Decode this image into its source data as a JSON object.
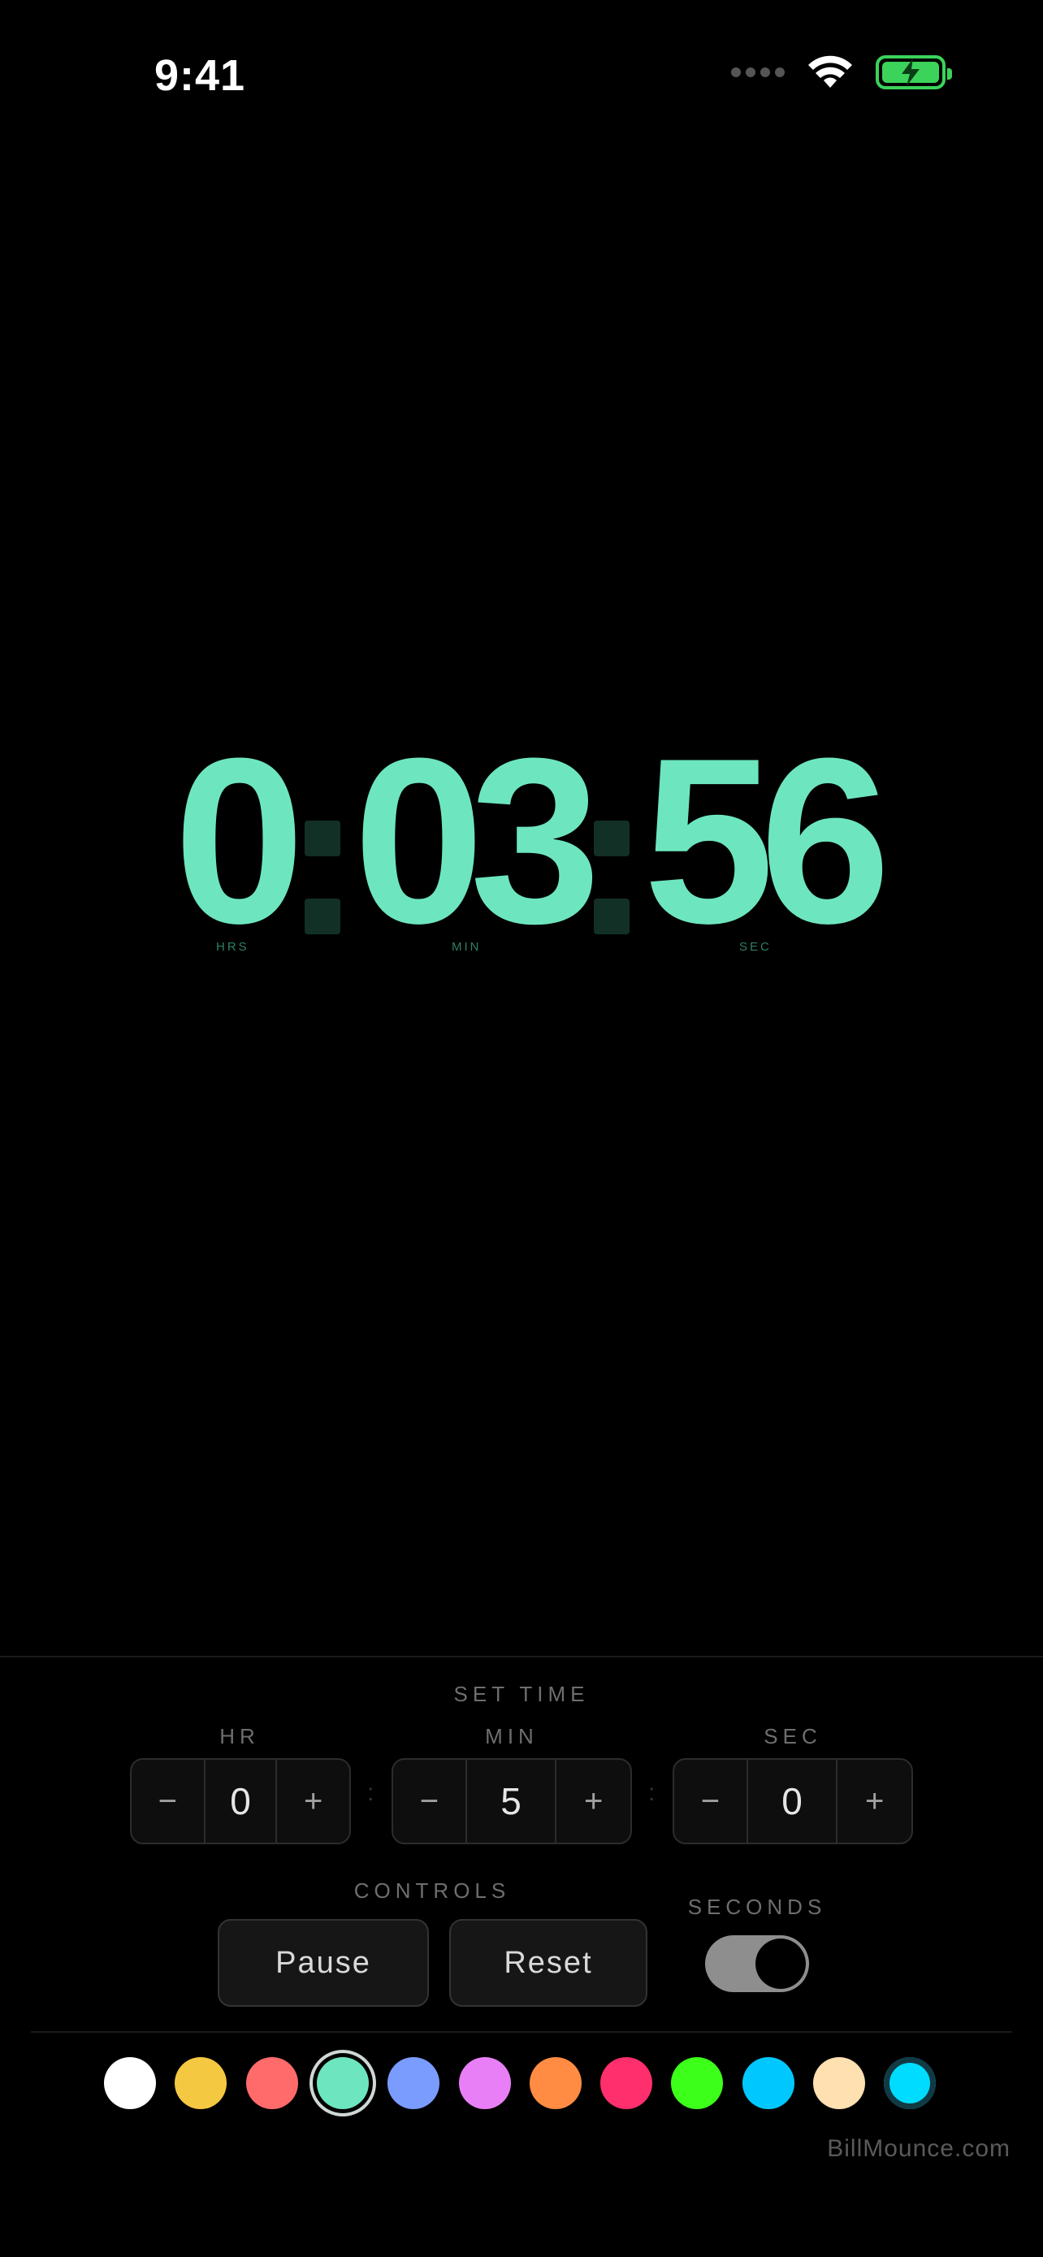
{
  "status_bar": {
    "time": "9:41"
  },
  "timer": {
    "hours": "0",
    "minutes": "03",
    "seconds": "56",
    "hours_label": "HRS",
    "minutes_label": "MIN",
    "seconds_label": "SEC",
    "digit_color": "#6de6c0"
  },
  "set_time": {
    "title": "SET TIME",
    "hr": {
      "label": "HR",
      "value": "0",
      "minus": "−",
      "plus": "+"
    },
    "min": {
      "label": "MIN",
      "value": "5",
      "minus": "−",
      "plus": "+"
    },
    "sec": {
      "label": "SEC",
      "value": "0",
      "minus": "−",
      "plus": "+"
    },
    "separator": ":"
  },
  "controls": {
    "title": "CONTROLS",
    "pause_label": "Pause",
    "reset_label": "Reset"
  },
  "seconds_toggle": {
    "title": "SECONDS",
    "on": true
  },
  "palette": {
    "colors": [
      "#ffffff",
      "#f5c842",
      "#ff6b6b",
      "#6de6c0",
      "#7b9cff",
      "#e97ff7",
      "#ff8c42",
      "#ff2f6d",
      "#3cff1a",
      "#00c8ff",
      "#ffe0b0",
      "#00dcff"
    ],
    "selected_index": 3
  },
  "footer": {
    "brand": "BillMounce.com"
  }
}
